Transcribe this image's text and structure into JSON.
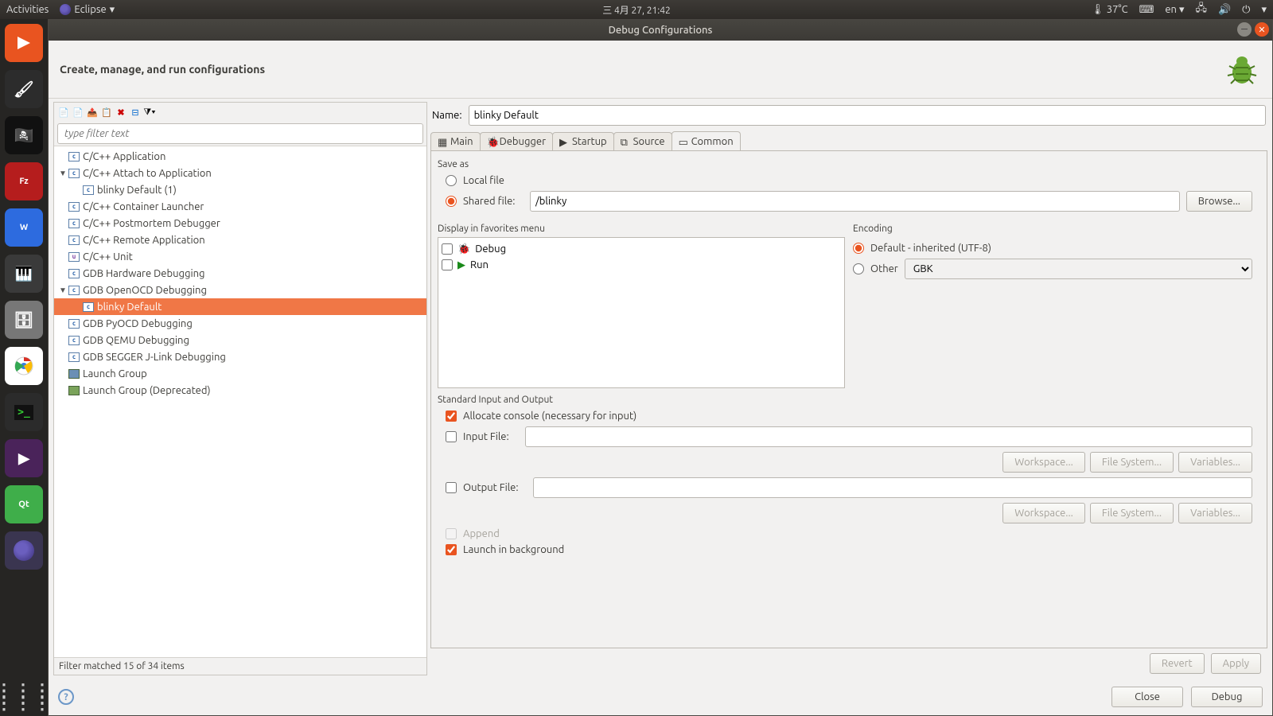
{
  "panel": {
    "activities": "Activities",
    "app": "Eclipse",
    "date": "三 4月  27, 21:42",
    "temp": "37°C",
    "lang": "en"
  },
  "window": {
    "title": "Debug Configurations",
    "heading": "Create, manage, and run configurations"
  },
  "filter": {
    "placeholder": "type filter text"
  },
  "tree": {
    "items": [
      {
        "l": "C/C++ Application",
        "d": 1,
        "tw": ""
      },
      {
        "l": "C/C++ Attach to Application",
        "d": 1,
        "tw": "▼"
      },
      {
        "l": "blinky Default (1)",
        "d": 2,
        "tw": ""
      },
      {
        "l": "C/C++ Container Launcher",
        "d": 1,
        "tw": ""
      },
      {
        "l": "C/C++ Postmortem Debugger",
        "d": 1,
        "tw": ""
      },
      {
        "l": "C/C++ Remote Application",
        "d": 1,
        "tw": ""
      },
      {
        "l": "C/C++ Unit",
        "d": 1,
        "tw": "",
        "ico": "cu"
      },
      {
        "l": "GDB Hardware Debugging",
        "d": 1,
        "tw": ""
      },
      {
        "l": "GDB OpenOCD Debugging",
        "d": 1,
        "tw": "▼"
      },
      {
        "l": "blinky Default",
        "d": 2,
        "tw": "",
        "sel": true
      },
      {
        "l": "GDB PyOCD Debugging",
        "d": 1,
        "tw": ""
      },
      {
        "l": "GDB QEMU Debugging",
        "d": 1,
        "tw": ""
      },
      {
        "l": "GDB SEGGER J-Link Debugging",
        "d": 1,
        "tw": ""
      },
      {
        "l": "Launch Group",
        "d": 1,
        "tw": "",
        "ico": "lg"
      },
      {
        "l": "Launch Group (Deprecated)",
        "d": 1,
        "tw": "",
        "ico": "lgd"
      }
    ],
    "status": "Filter matched 15 of 34 items"
  },
  "form": {
    "nameLabel": "Name:",
    "name": "blinky Default",
    "tabs": [
      "Main",
      "Debugger",
      "Startup",
      "Source",
      "Common"
    ],
    "saveAs": {
      "title": "Save as",
      "local": "Local file",
      "shared": "Shared file:",
      "sharedVal": "/blinky",
      "browse": "Browse..."
    },
    "fav": {
      "title": "Display in favorites menu",
      "debug": "Debug",
      "run": "Run"
    },
    "enc": {
      "title": "Encoding",
      "def": "Default - inherited (UTF-8)",
      "other": "Other",
      "otherVal": "GBK"
    },
    "io": {
      "title": "Standard Input and Output",
      "alloc": "Allocate console (necessary for input)",
      "inFile": "Input File:",
      "outFile": "Output File:",
      "ws": "Workspace...",
      "fs": "File System...",
      "vars": "Variables...",
      "append": "Append"
    },
    "launchBg": "Launch in background"
  },
  "buttons": {
    "revert": "Revert",
    "apply": "Apply",
    "close": "Close",
    "debug": "Debug"
  }
}
